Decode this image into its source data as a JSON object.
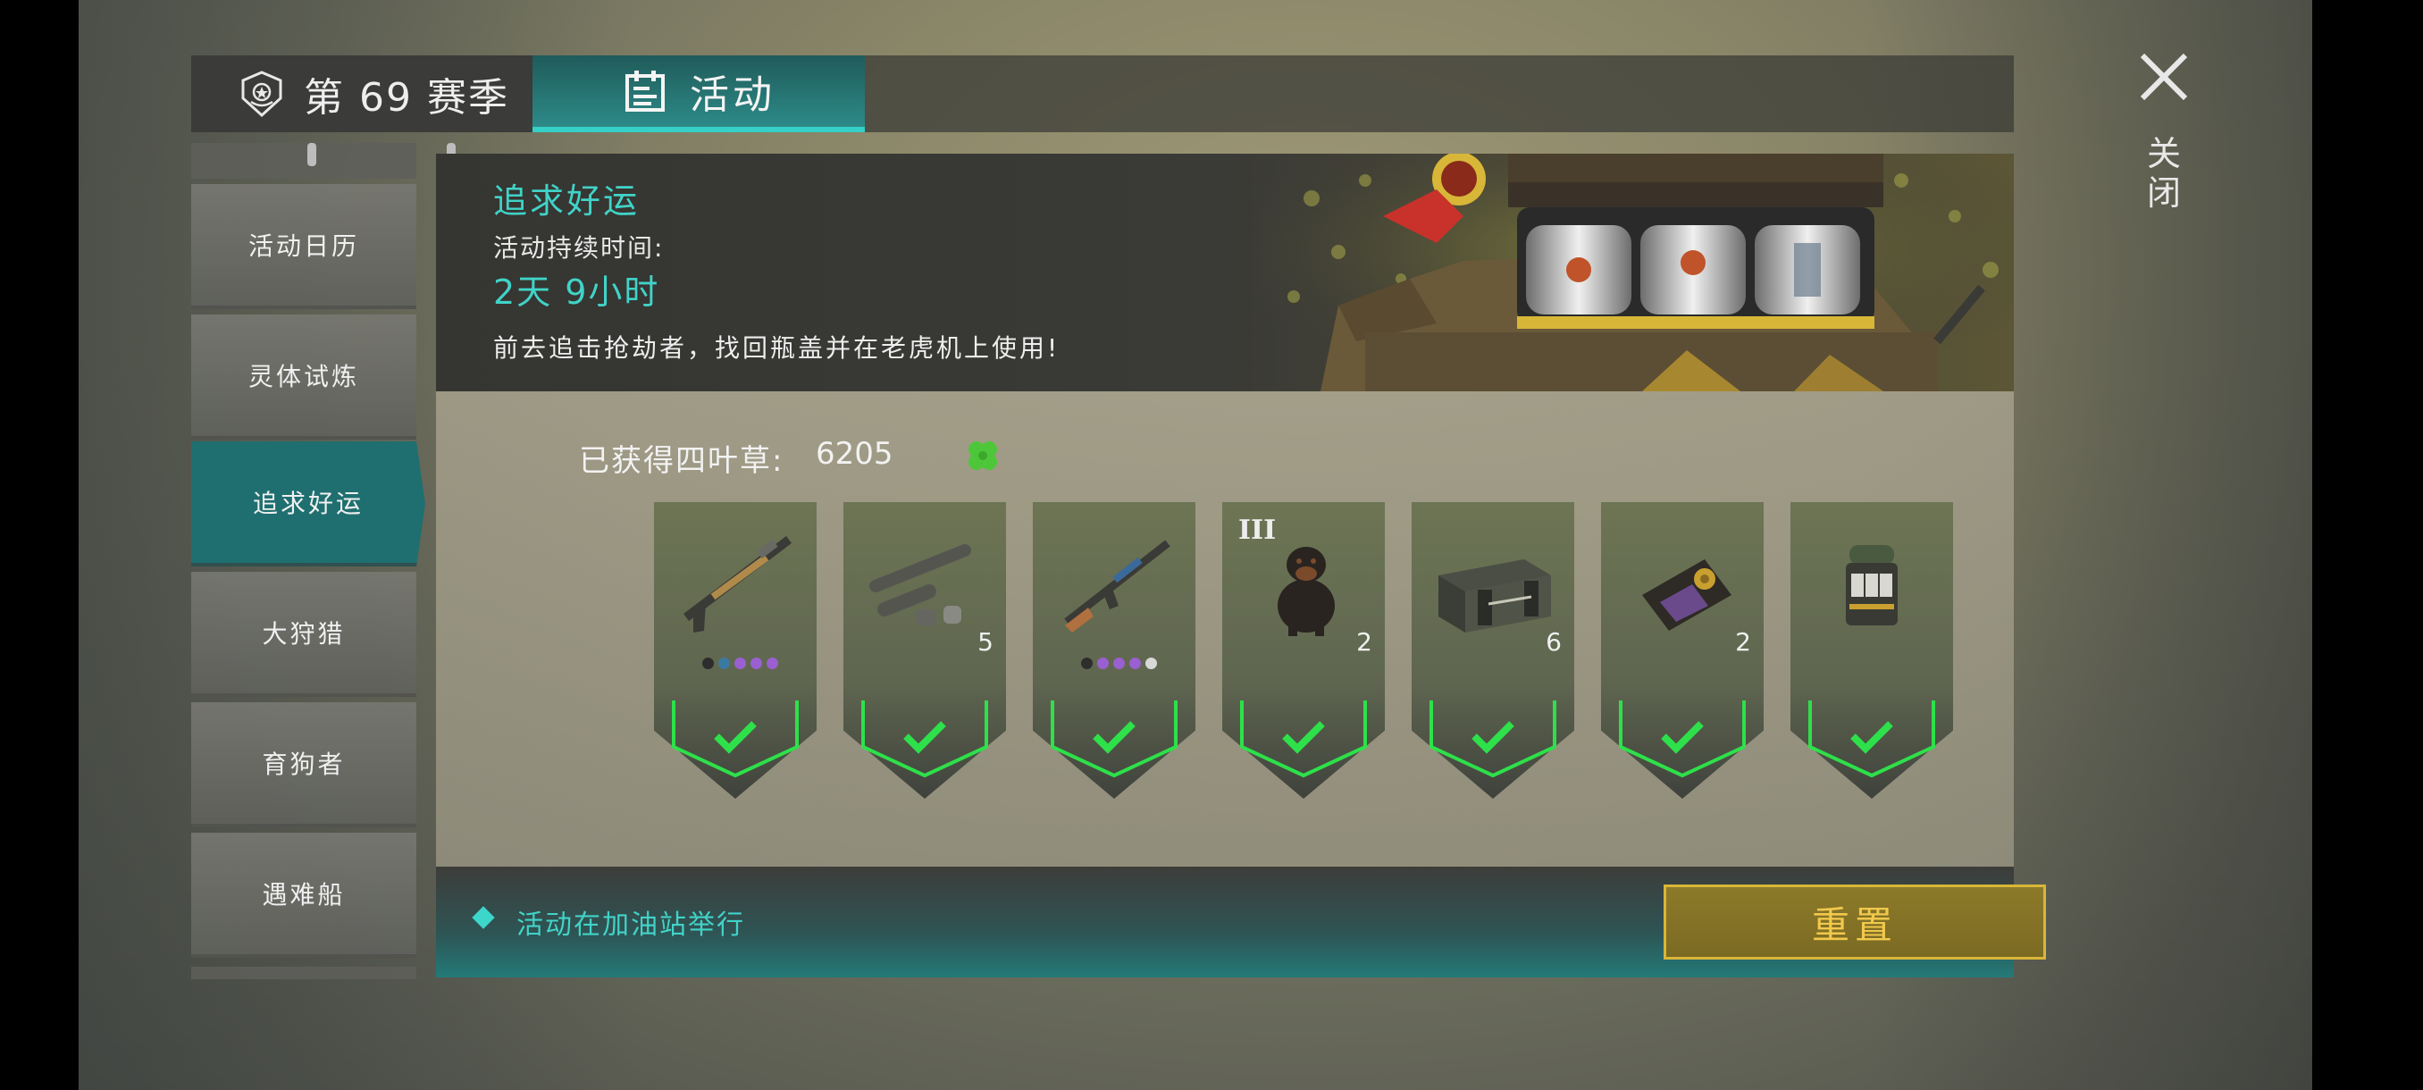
{
  "tabs": {
    "season_label": "第 69 赛季",
    "events_label": "活动"
  },
  "close": {
    "label": "关闭"
  },
  "sidebar": {
    "items": [
      {
        "label": "活动日历"
      },
      {
        "label": "灵体试炼"
      },
      {
        "label": "追求好运"
      },
      {
        "label": "大狩猎"
      },
      {
        "label": "育狗者"
      },
      {
        "label": "遇难船"
      }
    ],
    "active_index": 2
  },
  "banner": {
    "title": "追求好运",
    "duration_label": "活动持续时间:",
    "duration_value": "2天 9小时",
    "description": "前去追击抢劫者，找回瓶盖并在老虎机上使用!"
  },
  "clovers": {
    "label": "已获得四叶草:",
    "value": "6205"
  },
  "rewards": [
    {
      "icon": "shotgun-icon",
      "count": "",
      "tier": "",
      "claimed": true
    },
    {
      "icon": "launcher-parts-icon",
      "count": "5",
      "tier": "",
      "claimed": true
    },
    {
      "icon": "assault-rifle-icon",
      "count": "",
      "tier": "",
      "claimed": true
    },
    {
      "icon": "rottweiler-icon",
      "count": "2",
      "tier": "III",
      "claimed": true
    },
    {
      "icon": "weapon-crate-icon",
      "count": "6",
      "tier": "",
      "claimed": true
    },
    {
      "icon": "police-badge-wallet-icon",
      "count": "2",
      "tier": "",
      "claimed": true
    },
    {
      "icon": "slot-machine-icon",
      "count": "",
      "tier": "",
      "claimed": true
    }
  ],
  "footer": {
    "info": "活动在加油站举行",
    "reset_label": "重置"
  },
  "colors": {
    "accent_teal": "#41d3c8",
    "check_green": "#2ee04a",
    "reset_gold": "#f2c94c"
  }
}
